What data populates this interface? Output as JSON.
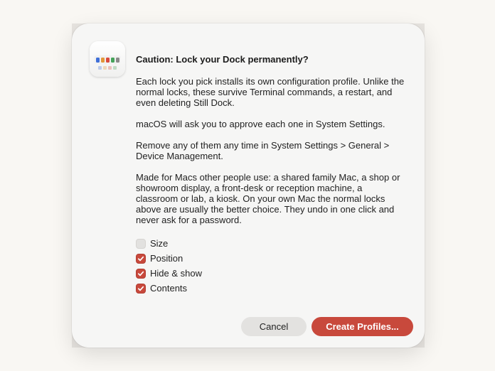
{
  "dialog": {
    "title": "Caution: Lock your Dock permanently?",
    "paragraphs": [
      "Each lock you pick installs its own configuration profile. Unlike the normal locks, these survive Terminal commands, a restart, and even deleting Still Dock.",
      "macOS will ask you to approve each one in System Settings.",
      "Remove any of them any time in System Settings > General > Device Management.",
      "Made for Macs other people use: a shared family Mac, a shop or showroom display, a front-desk or reception machine, a classroom or lab, a kiosk. On your own Mac the normal locks above are usually the better choice. They undo in one click and never ask for a password."
    ],
    "options": [
      {
        "label": "Size",
        "checked": false
      },
      {
        "label": "Position",
        "checked": true
      },
      {
        "label": "Hide & show",
        "checked": true
      },
      {
        "label": "Contents",
        "checked": true
      }
    ],
    "buttons": {
      "cancel": "Cancel",
      "create": "Create Profiles..."
    }
  },
  "app_icon": {
    "name": "still-dock-app-icon",
    "dock_colors": [
      "#3f6fd8",
      "#e2973a",
      "#d94a3d",
      "#46a35a",
      "#8a8a8a"
    ]
  },
  "colors": {
    "accent": "#c8493c",
    "checkbox_off": "#e2e1df",
    "cancel_button": "#e3e2e0",
    "dialog_background": "#f6f6f5"
  }
}
